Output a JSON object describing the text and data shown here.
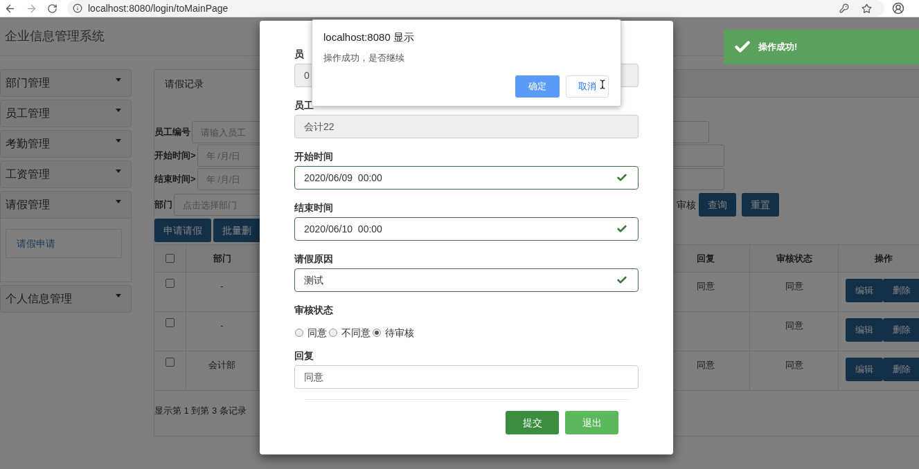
{
  "browser": {
    "url": "localhost:8080/login/toMainPage"
  },
  "header": {
    "title": "企业信息管理系统"
  },
  "sidebar": [
    {
      "label": "部门管理",
      "expanded": false
    },
    {
      "label": "员工管理",
      "expanded": false
    },
    {
      "label": "考勤管理",
      "expanded": false
    },
    {
      "label": "工资管理",
      "expanded": false
    },
    {
      "label": "请假管理",
      "expanded": true,
      "children": [
        {
          "label": "请假申请"
        }
      ]
    },
    {
      "label": "个人信息管理",
      "expanded": false
    }
  ],
  "panel": {
    "tab": "请假记录",
    "filters": [
      {
        "label": "员工编号",
        "placeholder": "请输入员工"
      },
      {
        "label": "开始时间>",
        "placeholder": "年 /月/日"
      },
      {
        "label": "结束时间>",
        "placeholder": "年 /月/日"
      },
      {
        "label": "部门",
        "placeholder": "点击选择部门"
      }
    ],
    "status_filter": "审核",
    "search_buttons": [
      "查询",
      "重置"
    ],
    "toolbar": [
      "申请请假",
      "批量删"
    ],
    "table": {
      "select_all": {
        "checked": false
      },
      "columns_left": [
        "部门"
      ],
      "columns_right": [
        "回复",
        "审核状态",
        "操作"
      ],
      "rows": [
        {
          "checked": false,
          "department": "-",
          "reply": "同意",
          "status": "同意",
          "actions": [
            "编辑",
            "删除"
          ]
        },
        {
          "checked": false,
          "department": "-",
          "reply": "",
          "status": "同意",
          "actions": [
            "编辑",
            "删除"
          ]
        },
        {
          "checked": false,
          "department": "会计部",
          "reply": "同意",
          "status": "同意",
          "actions": [
            "编辑",
            "删除"
          ]
        }
      ]
    },
    "footer": "显示第 1 到第 3 条记录"
  },
  "modal": {
    "fields": [
      {
        "label": "员",
        "value": "0",
        "disabled": true,
        "valid": false
      },
      {
        "label": "员工",
        "value": "会计22",
        "disabled": true,
        "valid": false
      },
      {
        "label": "开始时间",
        "value": "2020/06/09  00:00",
        "disabled": false,
        "valid": true
      },
      {
        "label": "结束时间",
        "value": "2020/06/10  00:00",
        "disabled": false,
        "valid": true
      },
      {
        "label": "请假原因",
        "value": "测试",
        "disabled": false,
        "valid": true
      }
    ],
    "status": {
      "label": "审核状态",
      "options": [
        {
          "label": "同意",
          "selected": false
        },
        {
          "label": "不同意",
          "selected": false
        },
        {
          "label": "待审核",
          "selected": true
        }
      ]
    },
    "reply": {
      "label": "回复",
      "value": "同意"
    },
    "buttons": [
      "提交",
      "退出"
    ]
  },
  "alert": {
    "title": "localhost:8080 显示",
    "message": "操作成功，是否继续",
    "buttons": [
      {
        "label": "确定",
        "focused": true
      },
      {
        "label": "取消",
        "focused": false
      }
    ]
  },
  "toast": {
    "message": "操作成功!"
  }
}
